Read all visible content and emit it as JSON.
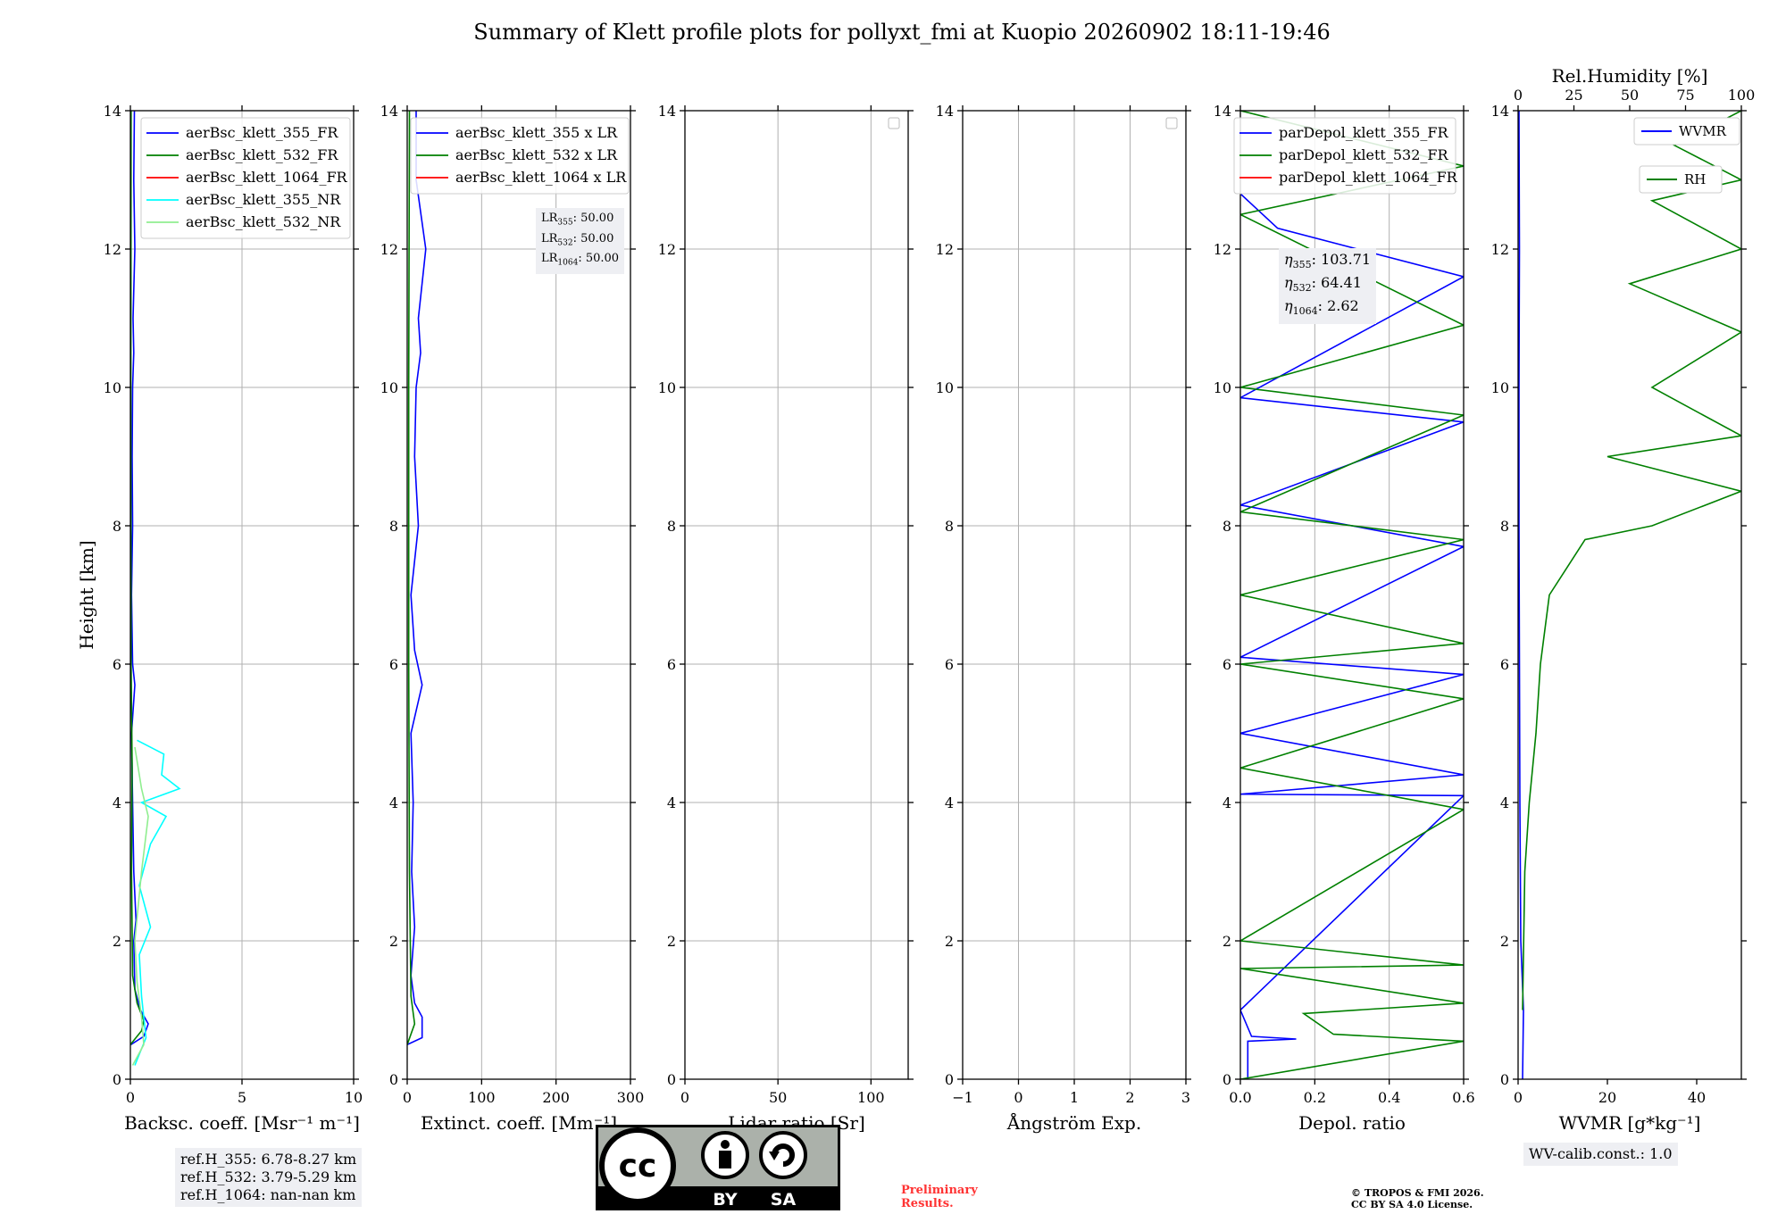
{
  "title": "Summary of Klett profile plots for pollyxt_fmi at Kuopio 20260902 18:11-19:46",
  "colors": {
    "blue": "#0000ff",
    "green": "#008000",
    "red": "#ff0000",
    "cyan": "#00ffff",
    "lightgreen": "#90ee90",
    "preliminary": "#ff3333",
    "annotation_bg": "#eeeff3"
  },
  "chart_data": [
    {
      "type": "line",
      "xlabel": "Backsc. coeff. [Msr⁻¹ m⁻¹]",
      "ylabel": "Height [km]",
      "xlim": [
        0,
        10
      ],
      "ylim": [
        0,
        14
      ],
      "xticks": [
        0,
        5,
        10
      ],
      "xtick_labels": [
        "0",
        "5",
        "10"
      ],
      "yticks": [
        0,
        2,
        4,
        6,
        8,
        10,
        12,
        14
      ],
      "grid": true,
      "legend": "top-right",
      "series": [
        {
          "name": "aerBsc_klett_355_FR",
          "color": "blue",
          "points": [
            [
              0.02,
              0.5
            ],
            [
              0.6,
              0.62
            ],
            [
              0.8,
              0.8
            ],
            [
              0.45,
              1.0
            ],
            [
              0.2,
              1.3
            ],
            [
              0.15,
              2.0
            ],
            [
              0.25,
              2.3
            ],
            [
              0.15,
              3.0
            ],
            [
              0.1,
              4.0
            ],
            [
              0.05,
              5.0
            ],
            [
              0.2,
              5.7
            ],
            [
              0.1,
              6.0
            ],
            [
              0.05,
              7.0
            ],
            [
              0.1,
              8.0
            ],
            [
              0.08,
              9.0
            ],
            [
              0.1,
              10.0
            ],
            [
              0.15,
              10.5
            ],
            [
              0.12,
              11.0
            ],
            [
              0.2,
              12.0
            ],
            [
              0.15,
              13.0
            ],
            [
              0.18,
              14.0
            ]
          ]
        },
        {
          "name": "aerBsc_klett_532_FR",
          "color": "green",
          "points": [
            [
              0.0,
              0.5
            ],
            [
              0.5,
              0.7
            ],
            [
              0.6,
              0.85
            ],
            [
              0.3,
              1.1
            ],
            [
              0.1,
              1.5
            ],
            [
              0.05,
              3.0
            ],
            [
              0.08,
              4.5
            ],
            [
              0.03,
              6.0
            ],
            [
              0.02,
              10.0
            ],
            [
              0.03,
              14.0
            ]
          ]
        },
        {
          "name": "aerBsc_klett_1064_FR",
          "color": "red",
          "points": []
        },
        {
          "name": "aerBsc_klett_355_NR",
          "color": "cyan",
          "points": [
            [
              0.2,
              0.2
            ],
            [
              0.7,
              0.6
            ],
            [
              0.5,
              1.2
            ],
            [
              0.4,
              1.8
            ],
            [
              0.9,
              2.2
            ],
            [
              0.4,
              2.8
            ],
            [
              0.9,
              3.4
            ],
            [
              1.6,
              3.8
            ],
            [
              0.5,
              4.0
            ],
            [
              2.2,
              4.2
            ],
            [
              1.4,
              4.4
            ],
            [
              1.5,
              4.7
            ],
            [
              0.3,
              4.9
            ]
          ]
        },
        {
          "name": "aerBsc_klett_532_NR",
          "color": "lightgreen",
          "points": [
            [
              0.1,
              0.2
            ],
            [
              0.6,
              0.5
            ],
            [
              0.5,
              0.9
            ],
            [
              0.3,
              1.4
            ],
            [
              0.2,
              2.0
            ],
            [
              0.5,
              3.0
            ],
            [
              0.8,
              3.8
            ],
            [
              0.5,
              4.2
            ],
            [
              0.2,
              4.8
            ]
          ]
        }
      ]
    },
    {
      "type": "line",
      "xlabel": "Extinct. coeff. [Mm⁻¹]",
      "xlim": [
        0,
        300
      ],
      "ylim": [
        0,
        14
      ],
      "xticks": [
        0,
        100,
        200,
        300
      ],
      "xtick_labels": [
        "0",
        "100",
        "200",
        "300"
      ],
      "yticks": [
        0,
        2,
        4,
        6,
        8,
        10,
        12,
        14
      ],
      "grid": true,
      "legend": "top-right",
      "series": [
        {
          "name": "aerBsc_klett_355 x LR",
          "color": "blue",
          "points": [
            [
              0,
              0.5
            ],
            [
              20,
              0.6
            ],
            [
              20,
              0.9
            ],
            [
              10,
              1.1
            ],
            [
              5,
              1.5
            ],
            [
              10,
              2.2
            ],
            [
              6,
              3.0
            ],
            [
              8,
              4.0
            ],
            [
              5,
              5.0
            ],
            [
              20,
              5.7
            ],
            [
              10,
              6.2
            ],
            [
              5,
              7.0
            ],
            [
              15,
              8.0
            ],
            [
              10,
              9.0
            ],
            [
              12,
              10.0
            ],
            [
              18,
              10.5
            ],
            [
              15,
              11.0
            ],
            [
              25,
              12.0
            ],
            [
              12,
              13.0
            ],
            [
              12,
              14.0
            ]
          ]
        },
        {
          "name": "aerBsc_klett_532 x LR",
          "color": "green",
          "points": [
            [
              0,
              0.5
            ],
            [
              10,
              0.8
            ],
            [
              5,
              1.2
            ],
            [
              3,
              3.0
            ],
            [
              2,
              6.0
            ],
            [
              2,
              10.0
            ],
            [
              3,
              14.0
            ]
          ]
        },
        {
          "name": "aerBsc_klett_1064 x LR",
          "color": "red",
          "points": []
        }
      ]
    },
    {
      "type": "line",
      "xlabel": "Lidar ratio [Sr]",
      "xlim": [
        0,
        120
      ],
      "ylim": [
        0,
        14
      ],
      "xticks": [
        0,
        50,
        100
      ],
      "xtick_labels": [
        "0",
        "50",
        "100"
      ],
      "yticks": [
        0,
        2,
        4,
        6,
        8,
        10,
        12,
        14
      ],
      "grid": true,
      "legend": "top-right",
      "series": []
    },
    {
      "type": "line",
      "xlabel": "Ångström Exp.",
      "xlim": [
        -1,
        3
      ],
      "ylim": [
        0,
        14
      ],
      "xticks": [
        -1,
        0,
        1,
        2,
        3
      ],
      "xtick_labels": [
        "−1",
        "0",
        "1",
        "2",
        "3"
      ],
      "yticks": [
        0,
        2,
        4,
        6,
        8,
        10,
        12,
        14
      ],
      "grid": true,
      "legend": "top-right",
      "series": []
    },
    {
      "type": "line",
      "xlabel": "Depol. ratio",
      "xlim": [
        0,
        0.6
      ],
      "ylim": [
        0,
        14
      ],
      "xticks": [
        0,
        0.2,
        0.4,
        0.6
      ],
      "xtick_labels": [
        "0.0",
        "0.2",
        "0.4",
        "0.6"
      ],
      "yticks": [
        0,
        2,
        4,
        6,
        8,
        10,
        12,
        14
      ],
      "grid": true,
      "legend": "top-right",
      "series": [
        {
          "name": "parDepol_klett_355_FR",
          "color": "blue",
          "points": [
            [
              0.02,
              0.0
            ],
            [
              0.02,
              0.55
            ],
            [
              0.15,
              0.58
            ],
            [
              0.03,
              0.62
            ],
            [
              0.0,
              1.0
            ],
            [
              0.6,
              4.1
            ],
            [
              0.0,
              4.12
            ],
            [
              0.6,
              4.4
            ],
            [
              0.0,
              5.0
            ],
            [
              0.6,
              5.85
            ],
            [
              0.0,
              6.1
            ],
            [
              0.6,
              7.7
            ],
            [
              0.0,
              8.3
            ],
            [
              0.6,
              9.5
            ],
            [
              0.0,
              9.85
            ],
            [
              0.6,
              11.6
            ],
            [
              0.1,
              12.3
            ],
            [
              0.0,
              12.8
            ]
          ]
        },
        {
          "name": "parDepol_klett_532_FR",
          "color": "green",
          "points": [
            [
              0.0,
              0.0
            ],
            [
              0.6,
              0.55
            ],
            [
              0.25,
              0.65
            ],
            [
              0.17,
              0.95
            ],
            [
              0.6,
              1.1
            ],
            [
              0.0,
              1.6
            ],
            [
              0.6,
              1.65
            ],
            [
              0.0,
              2.0
            ],
            [
              0.6,
              3.9
            ],
            [
              0.0,
              4.5
            ],
            [
              0.6,
              5.5
            ],
            [
              0.0,
              6.0
            ],
            [
              0.6,
              6.3
            ],
            [
              0.0,
              7.0
            ],
            [
              0.6,
              7.8
            ],
            [
              0.0,
              8.2
            ],
            [
              0.6,
              9.6
            ],
            [
              0.0,
              10.0
            ],
            [
              0.6,
              10.9
            ],
            [
              0.0,
              12.5
            ],
            [
              0.6,
              13.2
            ],
            [
              0.0,
              14.0
            ]
          ]
        },
        {
          "name": "parDepol_klett_1064_FR",
          "color": "red",
          "points": []
        }
      ]
    },
    {
      "type": "line",
      "xlabel": "WVMR [g*kg⁻¹]",
      "x2label": "Rel.Humidity [%]",
      "xlim": [
        0,
        50
      ],
      "x2lim": [
        0,
        100
      ],
      "ylim": [
        0,
        14
      ],
      "xticks": [
        0,
        20,
        40
      ],
      "xtick_labels": [
        "0",
        "20",
        "40"
      ],
      "x2ticks": [
        0,
        25,
        50,
        75,
        100
      ],
      "x2tick_labels": [
        "0",
        "25",
        "50",
        "75",
        "100"
      ],
      "yticks": [
        0,
        2,
        4,
        6,
        8,
        10,
        12,
        14
      ],
      "grid": false,
      "legend": "top-right",
      "series": [
        {
          "name": "WVMR",
          "color": "blue",
          "axis": "bottom",
          "points": [
            [
              1.0,
              0.0
            ],
            [
              1.2,
              1.0
            ],
            [
              0.6,
              2.0
            ],
            [
              0.4,
              4.0
            ],
            [
              0.3,
              6.0
            ],
            [
              0.2,
              8.0
            ],
            [
              0.2,
              10.0
            ],
            [
              0.3,
              12.0
            ],
            [
              0.2,
              14.0
            ]
          ]
        },
        {
          "name": "RH",
          "color": "green",
          "axis": "top",
          "points": [
            [
              2,
              1.0
            ],
            [
              3,
              3.0
            ],
            [
              5,
              4.0
            ],
            [
              8,
              5.0
            ],
            [
              10,
              6.0
            ],
            [
              14,
              7.0
            ],
            [
              30,
              7.8
            ],
            [
              60,
              8.0
            ],
            [
              100,
              8.5
            ],
            [
              40,
              9.0
            ],
            [
              100,
              9.3
            ],
            [
              60,
              10.0
            ],
            [
              100,
              10.8
            ],
            [
              50,
              11.5
            ],
            [
              100,
              12.0
            ],
            [
              60,
              12.7
            ],
            [
              100,
              13.0
            ],
            [
              70,
              13.5
            ],
            [
              100,
              14.0
            ]
          ]
        }
      ]
    }
  ],
  "annotations": {
    "lr": [
      {
        "prefix": "LR",
        "sub": "355",
        "value": ": 50.00"
      },
      {
        "prefix": "LR",
        "sub": "532",
        "value": ": 50.00"
      },
      {
        "prefix": "LR",
        "sub": "1064",
        "value": ": 50.00"
      }
    ],
    "eta": [
      {
        "prefix": "η",
        "sub": "355",
        "value": ": 103.71"
      },
      {
        "prefix": "η",
        "sub": "532",
        "value": ": 64.41"
      },
      {
        "prefix": "η",
        "sub": "1064",
        "value": ": 2.62"
      }
    ],
    "refH": [
      "ref.H_355: 6.78-8.27 km",
      "ref.H_532: 3.79-5.29 km",
      "ref.H_1064: nan-nan km"
    ],
    "wv_calib": "WV-calib.const.: 1.0"
  },
  "footer": {
    "preliminary": [
      "Preliminary",
      "Results."
    ],
    "copyright": [
      "© TROPOS & FMI 2026.",
      "CC BY SA 4.0 License."
    ],
    "cc_logo": {
      "cc": "cc",
      "by": "BY",
      "sa": "SA"
    }
  }
}
